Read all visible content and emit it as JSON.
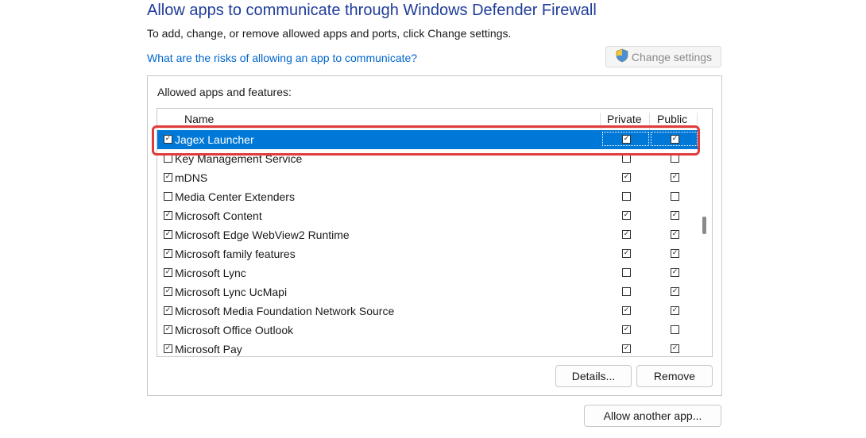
{
  "header": {
    "title": "Allow apps to communicate through Windows Defender Firewall",
    "subtitle": "To add, change, or remove allowed apps and ports, click Change settings.",
    "risk_link": "What are the risks of allowing an app to communicate?",
    "change_settings_label": "Change settings"
  },
  "panel": {
    "label": "Allowed apps and features:",
    "columns": [
      "Name",
      "Private",
      "Public"
    ],
    "rows": [
      {
        "name": "Jagex Launcher",
        "enabled": true,
        "private": true,
        "public": true,
        "selected": true
      },
      {
        "name": "Key Management Service",
        "enabled": false,
        "private": false,
        "public": false,
        "selected": false
      },
      {
        "name": "mDNS",
        "enabled": true,
        "private": true,
        "public": true,
        "selected": false
      },
      {
        "name": "Media Center Extenders",
        "enabled": false,
        "private": false,
        "public": false,
        "selected": false
      },
      {
        "name": "Microsoft Content",
        "enabled": true,
        "private": true,
        "public": true,
        "selected": false
      },
      {
        "name": "Microsoft Edge WebView2 Runtime",
        "enabled": true,
        "private": true,
        "public": true,
        "selected": false
      },
      {
        "name": "Microsoft family features",
        "enabled": true,
        "private": true,
        "public": true,
        "selected": false
      },
      {
        "name": "Microsoft Lync",
        "enabled": true,
        "private": false,
        "public": true,
        "selected": false
      },
      {
        "name": "Microsoft Lync UcMapi",
        "enabled": true,
        "private": false,
        "public": true,
        "selected": false
      },
      {
        "name": "Microsoft Media Foundation Network Source",
        "enabled": true,
        "private": true,
        "public": true,
        "selected": false
      },
      {
        "name": "Microsoft Office Outlook",
        "enabled": true,
        "private": true,
        "public": false,
        "selected": false
      },
      {
        "name": "Microsoft Pay",
        "enabled": true,
        "private": true,
        "public": true,
        "selected": false
      }
    ],
    "details_label": "Details...",
    "remove_label": "Remove"
  },
  "footer": {
    "allow_another_label": "Allow another app..."
  },
  "colors": {
    "title": "#1f3d99",
    "link": "#0066cc",
    "selection": "#0078d7",
    "highlight": "#e03c3c"
  }
}
